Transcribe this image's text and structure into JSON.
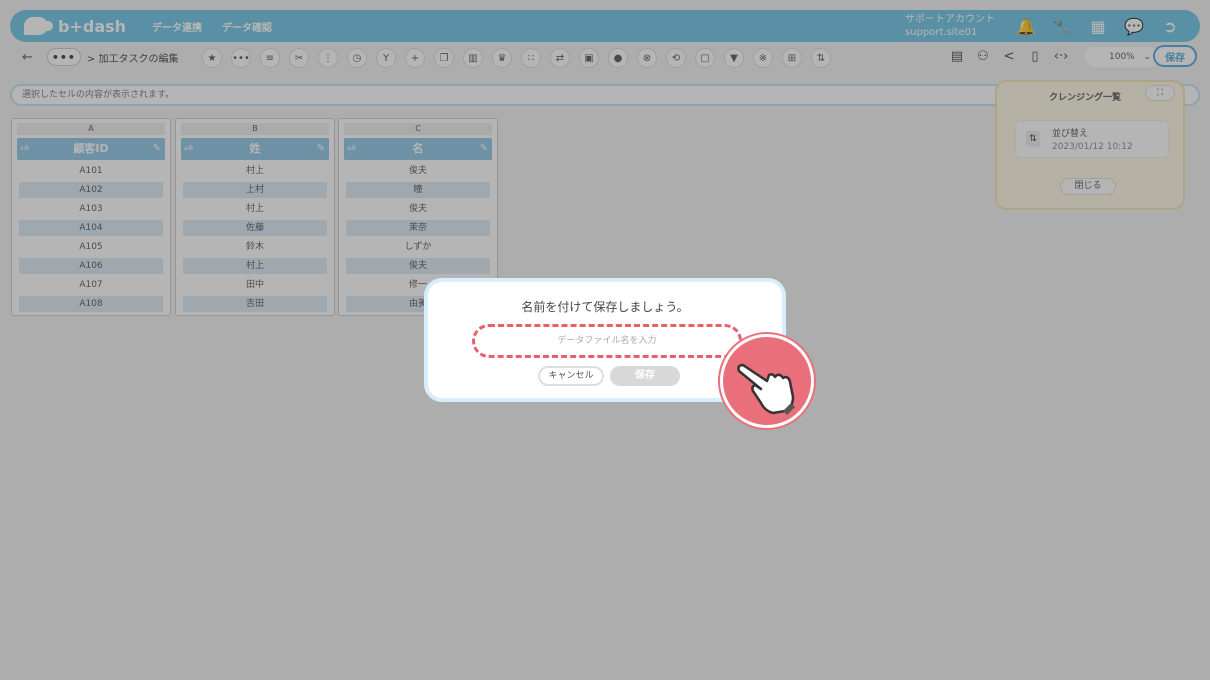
{
  "header": {
    "logo_text": "b+dash",
    "nav": [
      "データ連携",
      "データ確認"
    ],
    "account_label": "サポートアカウント",
    "account_id": "support.site01"
  },
  "toolbar": {
    "back_icon": "←",
    "more_label": "•••",
    "breadcrumb": "> 加工タスクの編集",
    "zoom": "100%",
    "save_label": "保存"
  },
  "cellbar": {
    "text": "選択したセルの内容が表示されます。"
  },
  "grid": {
    "columns": [
      {
        "letter": "A",
        "header": "顧客ID",
        "type_badge": "aあ",
        "cells": [
          "A101",
          "A102",
          "A103",
          "A104",
          "A105",
          "A106",
          "A107",
          "A108"
        ]
      },
      {
        "letter": "B",
        "header": "姓",
        "type_badge": "aあ",
        "cells": [
          "村上",
          "上村",
          "村上",
          "佐藤",
          "鈴木",
          "村上",
          "田中",
          "吉田"
        ]
      },
      {
        "letter": "C",
        "header": "名",
        "type_badge": "aあ",
        "cells": [
          "俊夫",
          "瞳",
          "俊夫",
          "茉奈",
          "しずか",
          "俊夫",
          "修一",
          "由美"
        ]
      }
    ]
  },
  "cleansing": {
    "title": "クレンジング一覧",
    "expand_icon": "⛶",
    "item_name": "並び替え",
    "item_date": "2023/01/12 10:12",
    "close_label": "閉じる"
  },
  "modal": {
    "title": "名前を付けて保存しましょう。",
    "input_placeholder": "データファイル名を入力",
    "input_value": "",
    "cancel_label": "キャンセル",
    "save_label": "保存"
  },
  "colors": {
    "header": "#6cc3e6",
    "accent": "#4aa8d8",
    "highlight": "#e8606a"
  }
}
